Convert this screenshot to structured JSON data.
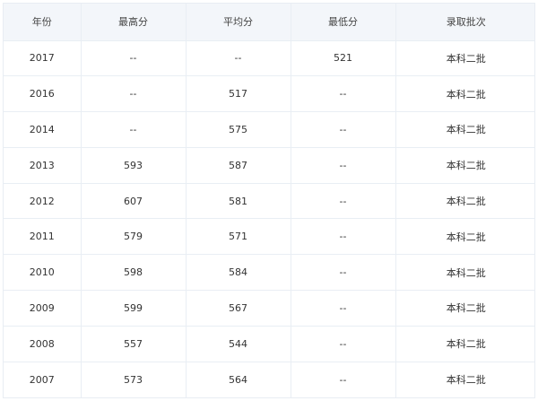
{
  "table": {
    "headers": [
      "年份",
      "最高分",
      "平均分",
      "最低分",
      "录取批次"
    ],
    "rows": [
      [
        "2017",
        "--",
        "--",
        "521",
        "本科二批"
      ],
      [
        "2016",
        "--",
        "517",
        "--",
        "本科二批"
      ],
      [
        "2014",
        "--",
        "575",
        "--",
        "本科二批"
      ],
      [
        "2013",
        "593",
        "587",
        "--",
        "本科二批"
      ],
      [
        "2012",
        "607",
        "581",
        "--",
        "本科二批"
      ],
      [
        "2011",
        "579",
        "571",
        "--",
        "本科二批"
      ],
      [
        "2010",
        "598",
        "584",
        "--",
        "本科二批"
      ],
      [
        "2009",
        "599",
        "567",
        "--",
        "本科二批"
      ],
      [
        "2008",
        "557",
        "544",
        "--",
        "本科二批"
      ],
      [
        "2007",
        "573",
        "564",
        "--",
        "本科二批"
      ]
    ]
  }
}
